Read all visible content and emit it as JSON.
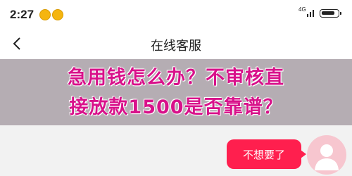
{
  "status_bar": {
    "time": "2:27",
    "network_label": "4G",
    "notification_icons": [
      "app-notification-icon",
      "app-notification-icon"
    ],
    "battery_level": 0.85
  },
  "header": {
    "back_icon": "chevron-left-icon",
    "title": "在线客服"
  },
  "banner": {
    "line1": "急用钱怎么办？不审核直",
    "line2": "接放款1500是否靠谱？"
  },
  "chat": {
    "messages": [
      {
        "sender": "user",
        "text": "不想要了"
      }
    ],
    "avatar_icon": "user-avatar-icon"
  },
  "colors": {
    "accent": "#ff1f4e",
    "banner_text": "#d8118a",
    "banner_bg": "#b5adb3"
  }
}
